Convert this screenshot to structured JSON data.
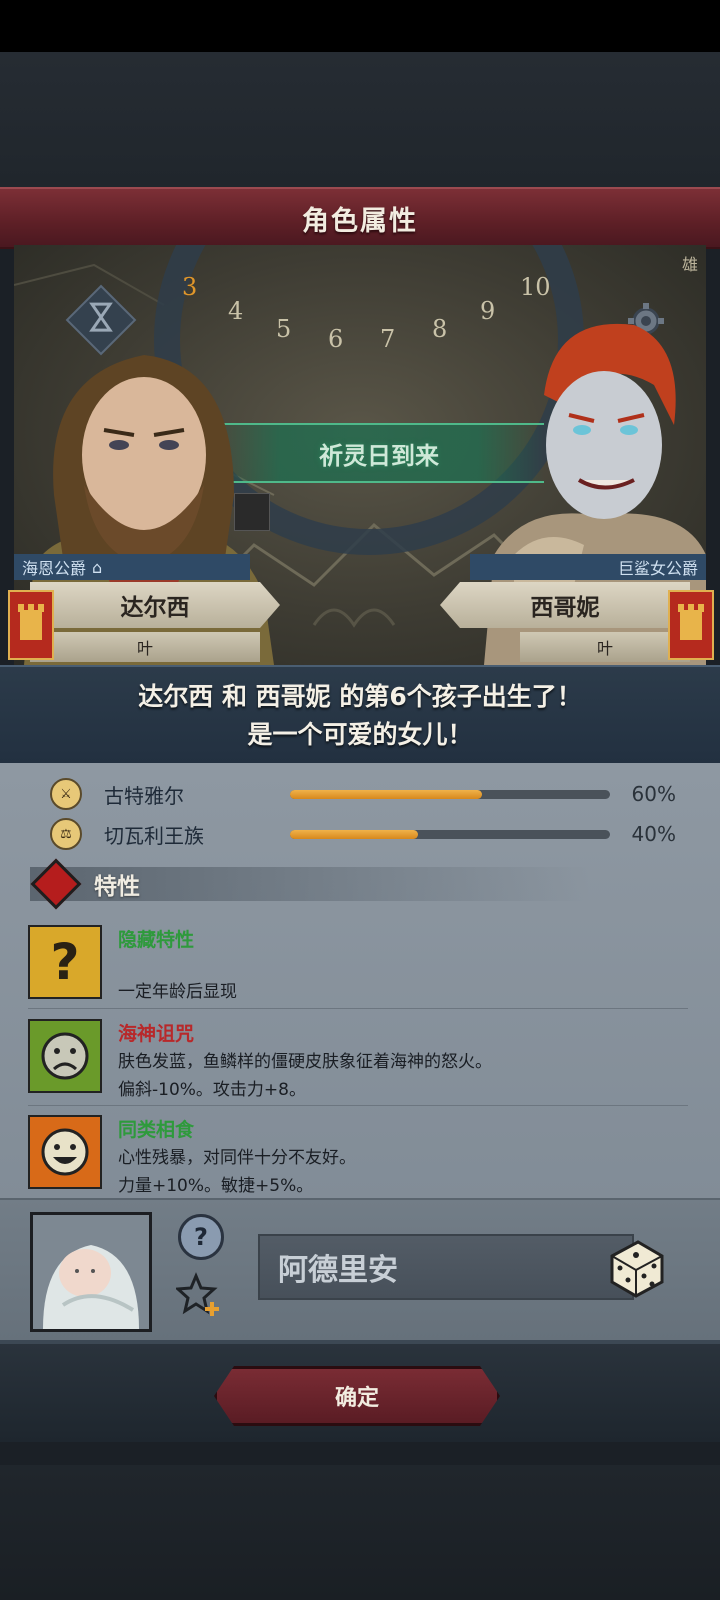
{
  "header": {
    "title": "角色属性"
  },
  "scene": {
    "event_banner": "祈灵日到来",
    "dial_numbers": [
      "3",
      "4",
      "5",
      "6",
      "7",
      "8",
      "9",
      "10"
    ],
    "corner_text": "雄"
  },
  "parents": {
    "father": {
      "title": "海恩公爵",
      "name": "达尔西",
      "sub": "叶"
    },
    "mother": {
      "title": "巨鲨女公爵",
      "name": "西哥妮",
      "sub": "叶"
    }
  },
  "announcement": {
    "line1": "达尔西 和 西哥妮 的第6个孩子出生了！",
    "line2": "是一个可爱的女儿！"
  },
  "bloodline": {
    "items": [
      {
        "name": "古特雅尔",
        "percent": 60,
        "percent_label": "60%"
      },
      {
        "name": "切瓦利王族",
        "percent": 40,
        "percent_label": "40%"
      }
    ]
  },
  "traits": {
    "label": "特性",
    "items": [
      {
        "name": "隐藏特性",
        "name_color": "#2e9a3c",
        "desc1": "",
        "desc2": "一定年龄后显现",
        "icon": "question-icon"
      },
      {
        "name": "海神诅咒",
        "name_color": "#b8282a",
        "desc1": "肤色发蓝，鱼鳞样的僵硬皮肤象征着海神的怒火。",
        "desc2": "偏斜-10%。攻击力+8。",
        "icon": "sad-face-icon"
      },
      {
        "name": "同类相食",
        "name_color": "#2e9a3c",
        "desc1": "心性残暴，对同伴十分不友好。",
        "desc2": "力量+10%。敏捷+5%。",
        "icon": "grin-face-icon"
      }
    ]
  },
  "child": {
    "name": "阿德里安"
  },
  "footer": {
    "confirm_label": "确定"
  }
}
